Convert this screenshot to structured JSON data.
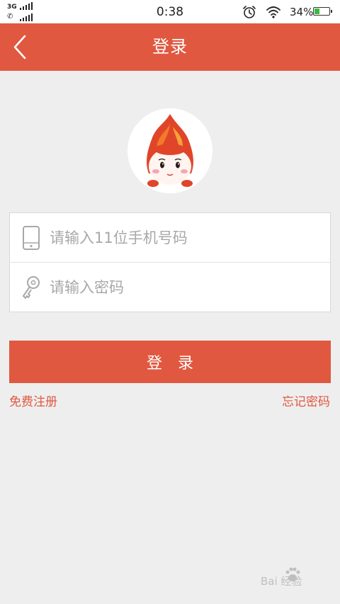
{
  "status_bar": {
    "network": "3G",
    "time": "0:38",
    "battery_percent": "34%",
    "battery_level": 0.34,
    "icons": [
      "signal-icon",
      "call-icon",
      "alarm-icon",
      "wifi-icon",
      "battery-icon"
    ]
  },
  "header": {
    "title": "登录",
    "back_icon": "chevron-left-icon"
  },
  "avatar": {
    "icon": "flame-mascot-avatar"
  },
  "form": {
    "phone_placeholder": "请输入11位手机号码",
    "phone_value": "",
    "phone_icon": "phone-icon",
    "password_placeholder": "请输入密码",
    "password_value": "",
    "password_icon": "key-icon"
  },
  "login_button": "登录",
  "links": {
    "register": "免费注册",
    "forgot_password": "忘记密码"
  },
  "watermark": {
    "text": "Bai 经验"
  },
  "colors": {
    "brand": "#e05840",
    "background": "#eeeeee",
    "placeholder": "#a8a8a8"
  }
}
